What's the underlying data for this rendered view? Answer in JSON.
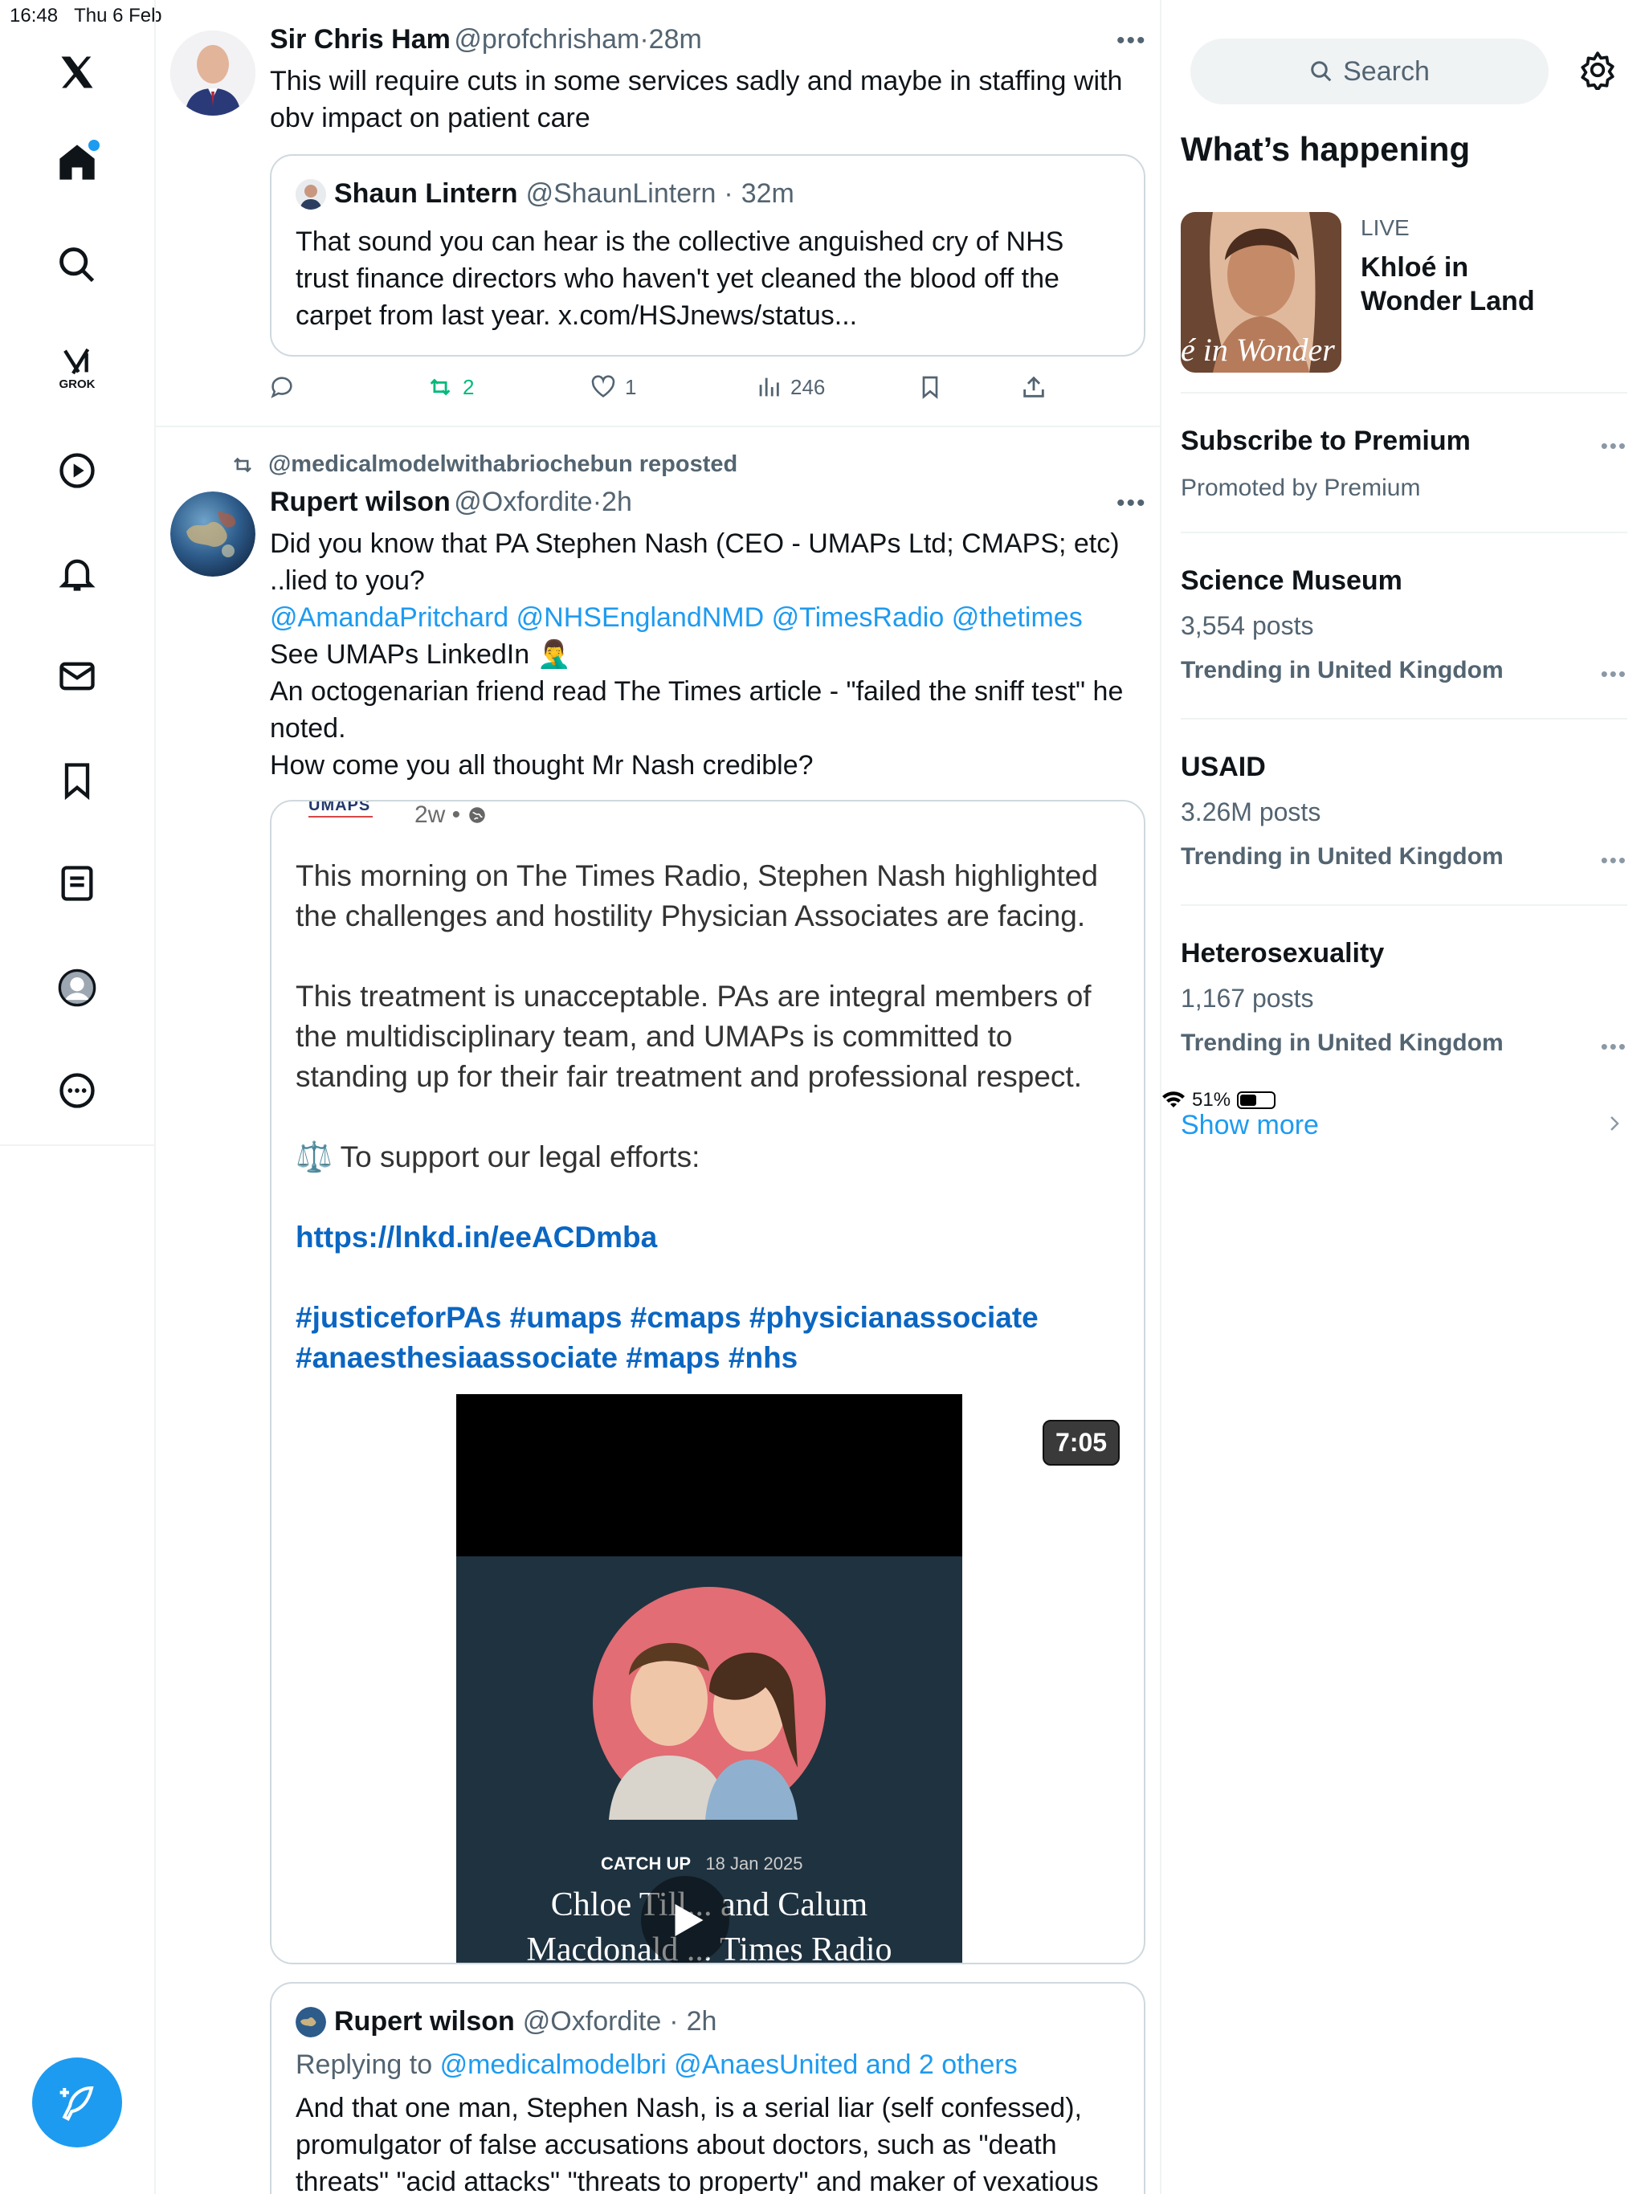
{
  "status_bar": {
    "time": "16:48",
    "date": "Thu 6 Feb",
    "battery": "51%",
    "battery_level": 0.51
  },
  "nav": {
    "items": [
      "x-logo",
      "home",
      "explore",
      "grok",
      "videos",
      "notifications",
      "messages",
      "bookmarks",
      "lists",
      "profile",
      "more"
    ],
    "grok_label": "GROK"
  },
  "tweet1": {
    "author": "Sir Chris Ham",
    "handle": "@profchrisham",
    "time": "28m",
    "text_line1": "This will require cuts in some services sadly and maybe in staffing with",
    "text_line2": "obv impact on patient care",
    "quote": {
      "author": "Shaun Lintern",
      "handle": "@ShaunLintern",
      "time": "32m",
      "line1": "That sound you can hear is the collective anguished cry of NHS",
      "line2": "trust finance directors who haven't yet cleaned the blood off the",
      "line3": "carpet from last year. x.com/HSJnews/status..."
    },
    "actions": {
      "reposts": "2",
      "likes": "1",
      "views": "246"
    }
  },
  "tweet2": {
    "repost_by": "@medicalmodelwithabriochebun reposted",
    "author": "Rupert wilson",
    "handle": "@Oxfordite",
    "time": "2h",
    "line1": "Did you know that PA Stephen Nash (CEO - UMAPs Ltd; CMAPS; etc)",
    "line2": "..lied to you?",
    "mentions": "@AmandaPritchard @NHSEnglandNMD @TimesRadio @thetimes",
    "line4": "See UMAPs LinkedIn 🤦‍♂️",
    "line5": "An octogenarian friend read The Times article - \"failed the sniff test\" he",
    "line6": "noted.",
    "line7": "How come you all thought Mr Nash credible?",
    "media": {
      "org": "UMAPS",
      "age": "2w •",
      "p1a": "This morning on The Times Radio, Stephen Nash highlighted",
      "p1b": "the challenges and hostility Physician Associates are facing.",
      "p2a": "This treatment is unacceptable. PAs are integral members of",
      "p2b": "the multidisciplinary team, and UMAPs is committed to",
      "p2c": "standing up for their fair treatment and professional respect.",
      "p3": "⚖️ To support our legal efforts:",
      "url": "https://lnkd.in/eeACDmba",
      "tags1": "#justiceforPAs #umaps #cmaps #physicianassociate",
      "tags2": "#anaesthesiaassociate #maps #nhs",
      "duration": "7:05",
      "catch_up": "CATCH UP",
      "catch_date": "18 Jan 2025",
      "video_title": "Chloe Till... and Calum",
      "video_title2": "Macdonald ... Times Radio"
    }
  },
  "tweet3": {
    "author": "Rupert wilson",
    "handle": "@Oxfordite",
    "time": "2h",
    "replying_prefix": "Replying to",
    "replying_to": "@medicalmodelbri @AnaesUnited and 2 others",
    "line1": "And that one man, Stephen Nash, is a serial liar (self confessed),",
    "line2": "promulgator of false accusations about doctors, such as \"death",
    "line3": "threats\" \"acid attacks\" \"threats to property\" and maker of vexatious"
  },
  "sidebar": {
    "search_placeholder": "Search",
    "section_title": "What’s happening",
    "live": {
      "label": "LIVE",
      "title_line1": "Khloé in",
      "title_line2": "Wonder Land",
      "thumb_text": "é in Wonder l"
    },
    "premium": {
      "title": "Subscribe to Premium",
      "sub": "Promoted by Premium"
    },
    "trends": [
      {
        "title": "Science Museum",
        "count": "3,554 posts",
        "context": "Trending in United Kingdom"
      },
      {
        "title": "USAID",
        "count": "3.26M posts",
        "context": "Trending in United Kingdom"
      },
      {
        "title": "Heterosexuality",
        "count": "1,167 posts",
        "context": "Trending in United Kingdom"
      }
    ],
    "show_more": "Show more"
  }
}
